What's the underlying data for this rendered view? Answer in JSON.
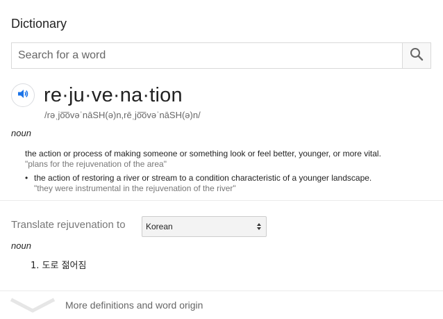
{
  "panel": {
    "title": "Dictionary"
  },
  "search": {
    "placeholder": "Search for a word",
    "icon": "search-icon"
  },
  "entry": {
    "speaker_icon": "speaker-icon",
    "headword": "re·ju·ve·na·tion",
    "phonetic": "/rəˌjo͞ovəˈnāSH(ə)n,rēˌjo͞ovəˈnāSH(ə)n/",
    "part_of_speech": "noun",
    "senses": [
      {
        "definition": "the action or process of making someone or something look or feel better, younger, or more vital.",
        "example": "\"plans for the rejuvenation of the area\""
      },
      {
        "bullet": "•",
        "definition": "the action of restoring a river or stream to a condition characteristic of a younger landscape.",
        "example": "\"they were instrumental in the rejuvenation of the river\""
      }
    ]
  },
  "translate": {
    "label": "Translate rejuvenation to",
    "selected_language": "Korean",
    "part_of_speech": "noun",
    "results": [
      "1. 도로 젊어짐"
    ]
  },
  "footer": {
    "more_label": "More definitions and word origin",
    "icon": "chevron-down-icon"
  },
  "colors": {
    "accent_blue": "#1a73e8",
    "muted_text": "#777777",
    "border": "#d9d9d9"
  }
}
